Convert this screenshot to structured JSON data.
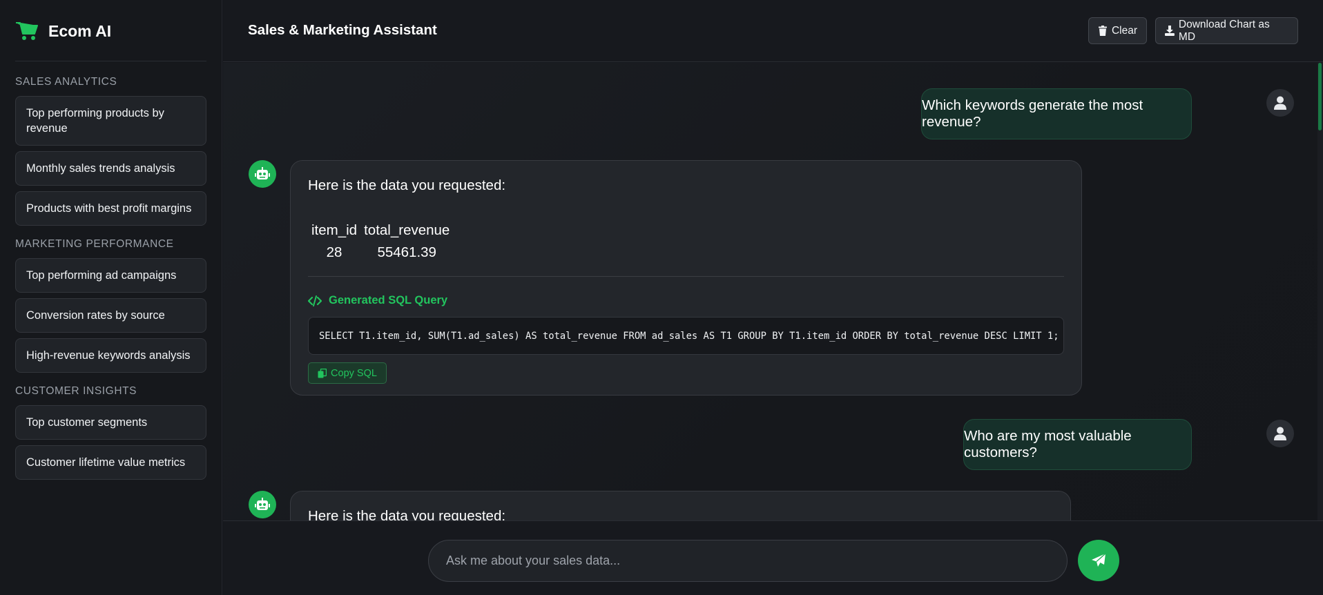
{
  "brand": {
    "name": "Ecom AI",
    "icon": "shopping-cart-icon",
    "accent": "#22c55e"
  },
  "sidebar": {
    "sections": [
      {
        "title": "SALES ANALYTICS",
        "items": [
          "Top performing products by revenue",
          "Monthly sales trends analysis",
          "Products with best profit margins"
        ]
      },
      {
        "title": "MARKETING PERFORMANCE",
        "items": [
          "Top performing ad campaigns",
          "Conversion rates by source",
          "High-revenue keywords analysis"
        ]
      },
      {
        "title": "CUSTOMER INSIGHTS",
        "items": [
          "Top customer segments",
          "Customer lifetime value metrics"
        ]
      }
    ]
  },
  "header": {
    "title": "Sales & Marketing Assistant",
    "clear_label": "Clear",
    "download_label": "Download Chart as MD"
  },
  "messages": [
    {
      "role": "user",
      "text": "Which keywords generate the most revenue?"
    },
    {
      "role": "bot",
      "intro": "Here is the data you requested:",
      "table": {
        "columns": [
          "item_id",
          "total_revenue"
        ],
        "rows": [
          [
            "28",
            "55461.39"
          ]
        ]
      },
      "sql_label": "Generated SQL Query",
      "sql": "SELECT T1.item_id, SUM(T1.ad_sales) AS total_revenue FROM ad_sales AS T1 GROUP BY T1.item_id ORDER BY total_revenue DESC LIMIT 1;",
      "copy_label": "Copy SQL"
    },
    {
      "role": "user",
      "text": "Who are my most valuable customers?"
    },
    {
      "role": "bot",
      "intro": "Here is the data you requested:"
    }
  ],
  "input": {
    "placeholder": "Ask me about your sales data..."
  }
}
